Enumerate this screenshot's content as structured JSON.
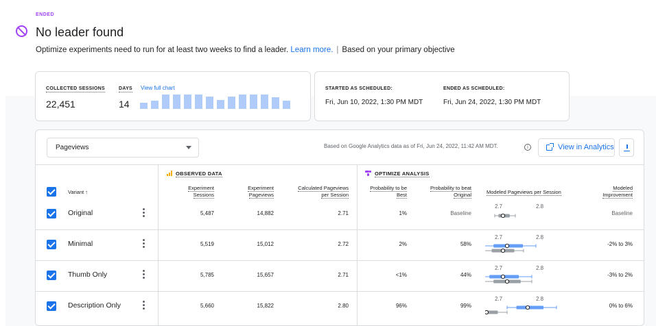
{
  "status": {
    "label": "ENDED",
    "headline": "No leader found",
    "message": "Optimize experiments need to run for at least two weeks to find a leader.",
    "learn_more": "Learn more.",
    "objective": "Based on your primary objective"
  },
  "summary": {
    "sessions_label": "COLLECTED SESSIONS",
    "sessions_value": "22,451",
    "days_label": "DAYS",
    "days_value": "14",
    "view_chart": "View full chart",
    "daily_sessions_relative": [
      0.4,
      0.55,
      0.95,
      0.95,
      0.95,
      0.95,
      0.8,
      0.6,
      0.8,
      0.95,
      0.95,
      0.95,
      0.75,
      0.55
    ],
    "started_label": "STARTED AS SCHEDULED:",
    "started_value": "Fri, Jun 10, 2022, 1:30 PM MDT",
    "ended_label": "ENDED AS SCHEDULED:",
    "ended_value": "Fri, Jun 24, 2022, 1:30 PM MDT"
  },
  "toolbar": {
    "objective_select": "Pageviews",
    "based_on": "Based on Google Analytics data as of Fri, Jun 24, 2022, 11:42 AM MDT.",
    "info_icon": "info-icon",
    "view_analytics": "View in Analytics",
    "download_icon": "download-icon"
  },
  "table": {
    "observed_group": "OBSERVED DATA",
    "optimize_group": "OPTIMIZE ANALYSIS",
    "col_variant": "Variant ↑",
    "col_sessions_1": "Experiment",
    "col_sessions_2": "Sessions",
    "col_pageviews_1": "Experiment",
    "col_pageviews_2": "Pageviews",
    "col_calc_1": "Calculated Pageviews",
    "col_calc_2": "per Session",
    "col_best_1": "Probability to be",
    "col_best_2": "Best",
    "col_beat_1": "Probability to beat",
    "col_beat_2": "Original",
    "col_modeled": "Modeled Pageviews per Session",
    "col_improve_1": "Modeled",
    "col_improve_2": "Improvement",
    "rows": [
      {
        "name": "Original",
        "sessions": "5,487",
        "pageviews": "14,882",
        "calc": "2.71",
        "best": "1%",
        "beat": "Baseline",
        "improvement": "Baseline",
        "tick_low": "2.7",
        "tick_high": "2.8",
        "blue_ci": null,
        "gray_ci": [
          2.69,
          2.74
        ],
        "gray_mid": 2.71
      },
      {
        "name": "Minimal",
        "sessions": "5,519",
        "pageviews": "15,012",
        "calc": "2.72",
        "best": "2%",
        "beat": "58%",
        "improvement": "-2% to 3%",
        "tick_low": "2.7",
        "tick_high": "2.8",
        "blue_ci": [
          2.66,
          2.79
        ],
        "blue_mid": 2.72,
        "gray_ci": [
          2.66,
          2.76
        ],
        "gray_mid": 2.71
      },
      {
        "name": "Thumb Only",
        "sessions": "5,785",
        "pageviews": "15,657",
        "calc": "2.71",
        "best": "<1%",
        "beat": "44%",
        "improvement": "-3% to 2%",
        "tick_low": "2.7",
        "tick_high": "2.8",
        "blue_ci": [
          2.65,
          2.78
        ],
        "blue_mid": 2.71,
        "gray_ci": [
          2.66,
          2.78
        ],
        "gray_mid": 2.72
      },
      {
        "name": "Description Only",
        "sessions": "5,660",
        "pageviews": "15,822",
        "calc": "2.80",
        "best": "96%",
        "beat": "99%",
        "improvement": "0% to 6%",
        "tick_low": "2.7",
        "tick_high": "2.8",
        "blue_ci": [
          2.72,
          2.84
        ],
        "blue_mid": 2.77,
        "gray_ci": [
          2.62,
          2.72
        ],
        "gray_mid": 2.67
      }
    ]
  },
  "colors": {
    "accent": "#1a73e8",
    "purple": "#a142f4",
    "ci_blue": "#669df6",
    "ci_gray": "#9aa0a6"
  }
}
